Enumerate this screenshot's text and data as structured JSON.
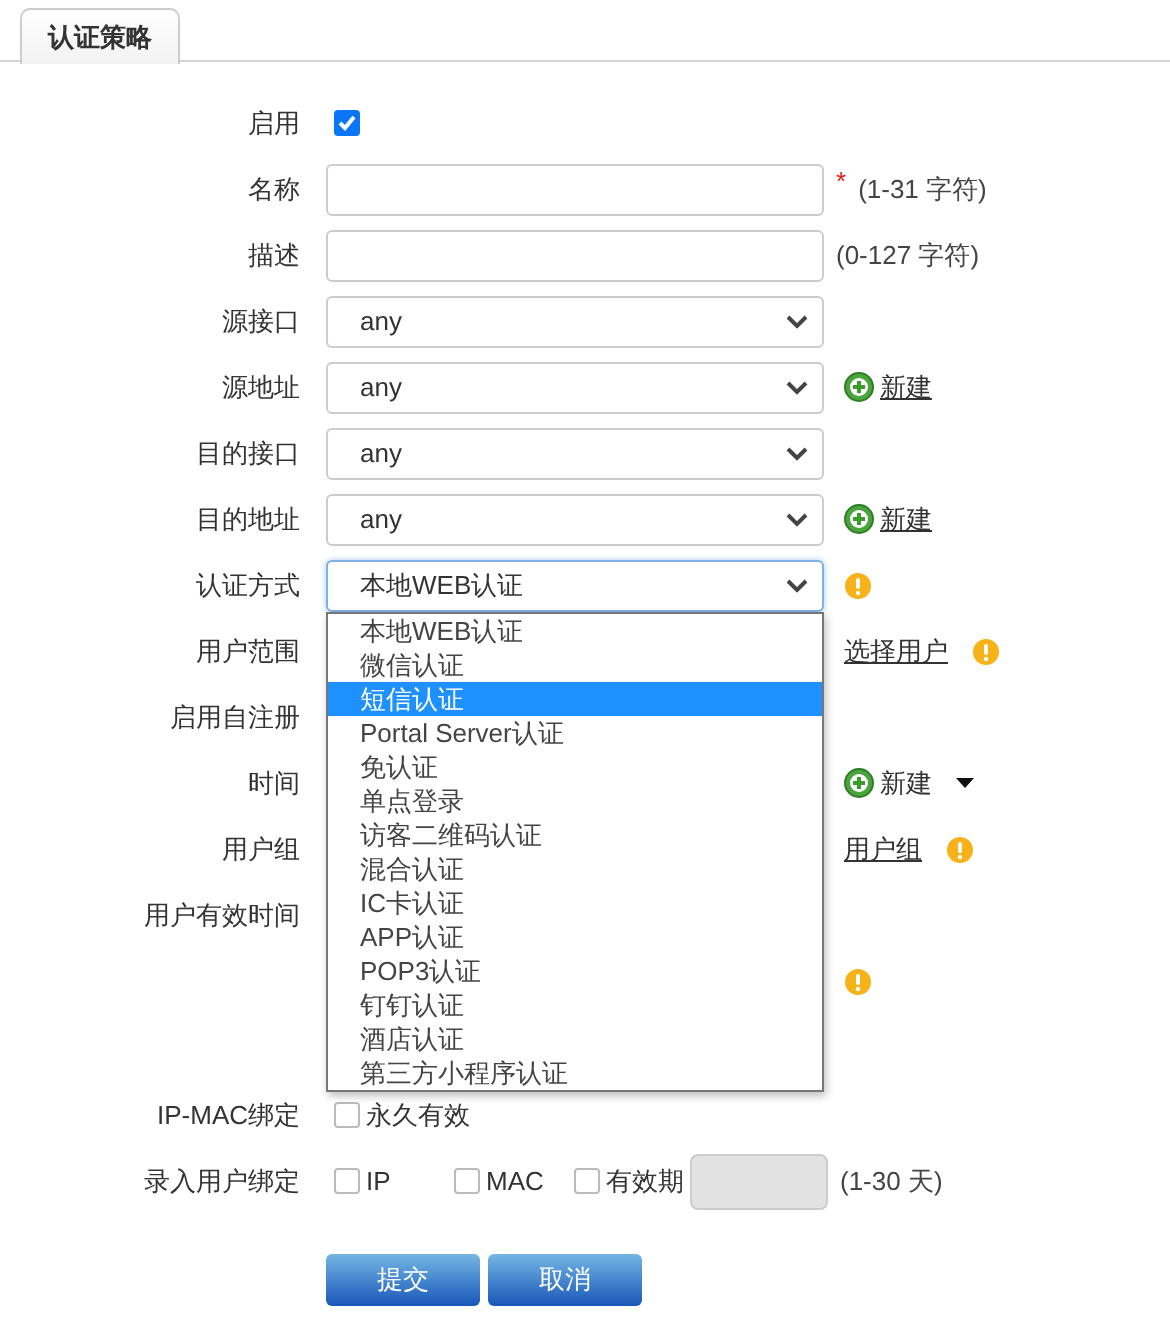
{
  "tabs": [
    {
      "label": "认证策略",
      "selected": true
    }
  ],
  "rows": [
    {
      "kind": "checkbox",
      "label": "启用",
      "options": [
        {
          "checked": true
        }
      ]
    },
    {
      "kind": "text",
      "label": "名称",
      "required_mark": "*",
      "hint": "(1-31 字符)"
    },
    {
      "kind": "text",
      "label": "描述",
      "hint": "(0-127 字符)"
    },
    {
      "kind": "select",
      "label": "源接口",
      "value": "any"
    },
    {
      "kind": "select",
      "label": "源地址",
      "value": "any",
      "extras": [
        {
          "kind": "add-link",
          "label": "新建"
        }
      ]
    },
    {
      "kind": "select",
      "label": "目的接口",
      "value": "any"
    },
    {
      "kind": "select",
      "label": "目的地址",
      "value": "any",
      "extras": [
        {
          "kind": "add-link",
          "label": "新建"
        }
      ]
    },
    {
      "kind": "select",
      "label": "认证方式",
      "value": "本地WEB认证",
      "focused": true,
      "extras": [
        {
          "kind": "warning"
        }
      ],
      "dropdown": {
        "options": [
          {
            "label": "本地WEB认证",
            "selected": false
          },
          {
            "label": "微信认证",
            "selected": false
          },
          {
            "label": "短信认证",
            "selected": true
          },
          {
            "label": "Portal Server认证",
            "selected": false
          },
          {
            "label": "免认证",
            "selected": false
          },
          {
            "label": "单点登录",
            "selected": false
          },
          {
            "label": "访客二维码认证",
            "selected": false
          },
          {
            "label": "混合认证",
            "selected": false
          },
          {
            "label": "IC卡认证",
            "selected": false
          },
          {
            "label": "APP认证",
            "selected": false
          },
          {
            "label": "POP3认证",
            "selected": false
          },
          {
            "label": "钉钉认证",
            "selected": false
          },
          {
            "label": "酒店认证",
            "selected": false
          },
          {
            "label": "第三方小程序认证",
            "selected": false
          }
        ]
      }
    },
    {
      "kind": "blank",
      "label": "用户范围",
      "extras": [
        {
          "kind": "link",
          "label": "选择用户"
        },
        {
          "kind": "warning"
        }
      ]
    },
    {
      "kind": "blank",
      "label": "启用自注册"
    },
    {
      "kind": "blank",
      "label": "时间",
      "extras": [
        {
          "kind": "add-menu",
          "label": "新建"
        }
      ]
    },
    {
      "kind": "blank",
      "label": "用户组",
      "extras": [
        {
          "kind": "link",
          "label": "用户组"
        },
        {
          "kind": "warning"
        }
      ]
    },
    {
      "kind": "blank",
      "label": "用户有效时间"
    },
    {
      "kind": "blank",
      "extras": [
        {
          "kind": "warning"
        }
      ]
    }
  ],
  "binding_rows": [
    {
      "kind": "checkbox",
      "label": "IP-MAC绑定",
      "options": [
        {
          "label": "永久有效",
          "checked": false
        }
      ]
    },
    {
      "kind": "checkbox",
      "label": "录入用户绑定",
      "options": [
        {
          "label": "IP",
          "checked": false
        },
        {
          "label": "MAC",
          "checked": false
        },
        {
          "label": "有效期",
          "checked": false
        }
      ],
      "field_disabled": true,
      "hint": "(1-30 天)"
    }
  ],
  "buttons": [
    {
      "label": "提交"
    },
    {
      "label": "取消"
    }
  ]
}
